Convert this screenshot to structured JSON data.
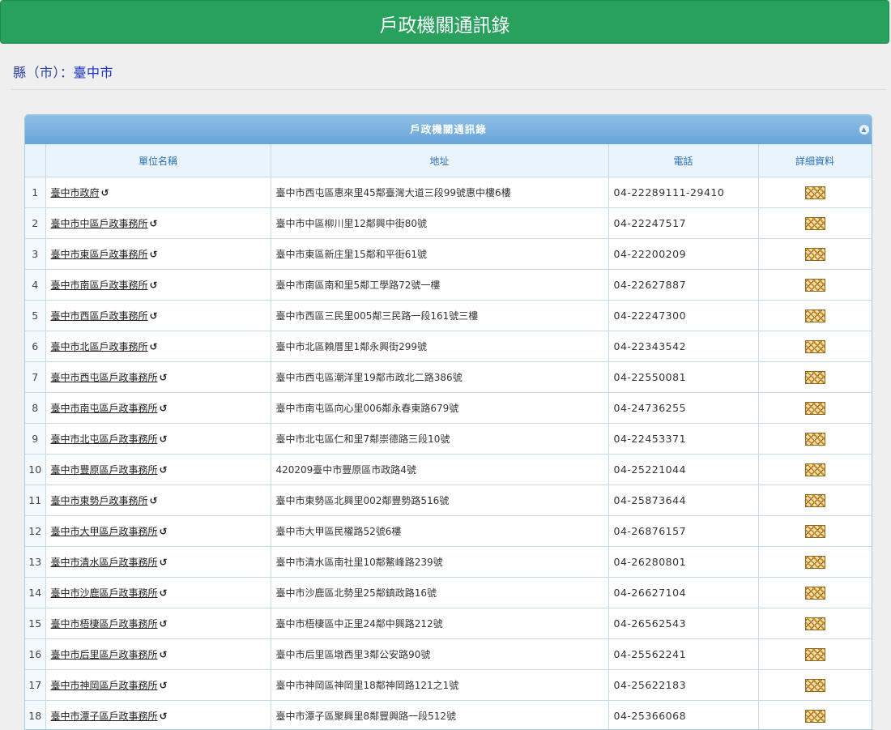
{
  "header": {
    "title": "戶政機關通訊錄"
  },
  "county": {
    "label": "縣（市）：",
    "value": "臺中市"
  },
  "grid": {
    "caption": "戶政機關通訊錄",
    "columns": [
      "單位名稱",
      "地址",
      "電話",
      "詳細資料"
    ],
    "rows": [
      {
        "no": "1",
        "name": "臺中市政府",
        "address": "臺中市西屯區惠來里45鄰臺灣大道三段99號惠中樓6樓",
        "phone": "04-22289111-29410"
      },
      {
        "no": "2",
        "name": "臺中市中區戶政事務所",
        "address": "臺中市中區柳川里12鄰興中街80號",
        "phone": "04-22247517"
      },
      {
        "no": "3",
        "name": "臺中市東區戶政事務所",
        "address": "臺中市東區新庄里15鄰和平街61號",
        "phone": "04-22200209"
      },
      {
        "no": "4",
        "name": "臺中市南區戶政事務所",
        "address": "臺中市南區南和里5鄰工學路72號一樓",
        "phone": "04-22627887"
      },
      {
        "no": "5",
        "name": "臺中市西區戶政事務所",
        "address": "臺中市西區三民里005鄰三民路一段161號三樓",
        "phone": "04-22247300"
      },
      {
        "no": "6",
        "name": "臺中市北區戶政事務所",
        "address": "臺中市北區賴厝里1鄰永興街299號",
        "phone": "04-22343542"
      },
      {
        "no": "7",
        "name": "臺中市西屯區戶政事務所",
        "address": "臺中市西屯區潮洋里19鄰市政北二路386號",
        "phone": "04-22550081"
      },
      {
        "no": "8",
        "name": "臺中市南屯區戶政事務所",
        "address": "臺中市南屯區向心里006鄰永春東路679號",
        "phone": "04-24736255"
      },
      {
        "no": "9",
        "name": "臺中市北屯區戶政事務所",
        "address": "臺中市北屯區仁和里7鄰崇德路三段10號",
        "phone": "04-22453371"
      },
      {
        "no": "10",
        "name": "臺中市豐原區戶政事務所",
        "address": "420209臺中市豐原區市政路4號",
        "phone": "04-25221044"
      },
      {
        "no": "11",
        "name": "臺中市東勢戶政事務所",
        "address": "臺中市東勢區北興里002鄰豐勢路516號",
        "phone": "04-25873644"
      },
      {
        "no": "12",
        "name": "臺中市大甲區戶政事務所",
        "address": "臺中市大甲區民權路52號6樓",
        "phone": "04-26876157"
      },
      {
        "no": "13",
        "name": "臺中市清水區戶政事務所",
        "address": "臺中市清水區南社里10鄰鰲峰路239號",
        "phone": "04-26280801"
      },
      {
        "no": "14",
        "name": "臺中市沙鹿區戶政事務所",
        "address": "臺中市沙鹿區北勢里25鄰鎮政路16號",
        "phone": "04-26627104"
      },
      {
        "no": "15",
        "name": "臺中市梧棲區戶政事務所",
        "address": "臺中市梧棲區中正里24鄰中興路212號",
        "phone": "04-26562543"
      },
      {
        "no": "16",
        "name": "臺中市后里區戶政事務所",
        "address": "臺中市后里區墩西里3鄰公安路90號",
        "phone": "04-25562241"
      },
      {
        "no": "17",
        "name": "臺中市神岡區戶政事務所",
        "address": "臺中市神岡區神岡里18鄰神岡路121之1號",
        "phone": "04-25622183"
      },
      {
        "no": "18",
        "name": "臺中市潭子區戶政事務所",
        "address": "臺中市潭子區聚興里8鄰豐興路一段512號",
        "phone": "04-25366068"
      }
    ]
  },
  "icons": {
    "external_link": "external-link-icon",
    "detail": "map-detail-icon",
    "collapse": "chevron-up-icon"
  },
  "colors": {
    "header_bg": "#27a15c",
    "grid_caption": "#7fb5e2",
    "link_text": "#222222",
    "county_text": "#2a3fa0"
  }
}
